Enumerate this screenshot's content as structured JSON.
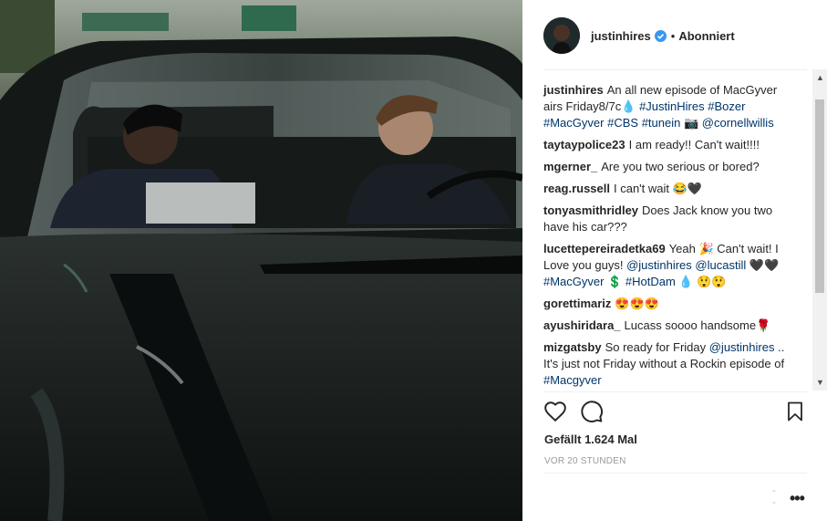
{
  "post": {
    "username": "justinhires",
    "dot": "•",
    "follow_status": "Abonniert",
    "likes": "Gefällt 1.624 Mal",
    "time": "VOR 20 STUNDEN",
    "more_label": "•••"
  },
  "comments": [
    {
      "user": "justinhires",
      "parts": [
        {
          "t": "An all new episode of MacGyver airs Friday8/7c💧 "
        },
        {
          "t": "#JustinHires",
          "link": true
        },
        {
          "t": " "
        },
        {
          "t": "#Bozer",
          "link": true
        },
        {
          "t": " "
        },
        {
          "t": "#MacGyver",
          "link": true
        },
        {
          "t": " "
        },
        {
          "t": "#CBS",
          "link": true
        },
        {
          "t": " "
        },
        {
          "t": "#tunein",
          "link": true
        },
        {
          "t": " 📷 "
        },
        {
          "t": "@cornellwillis",
          "link": true
        }
      ]
    },
    {
      "user": "taytaypolice23",
      "parts": [
        {
          "t": "I am ready!! Can't wait!!!!"
        }
      ]
    },
    {
      "user": "mgerner_",
      "parts": [
        {
          "t": "Are you two serious or bored?"
        }
      ]
    },
    {
      "user": "reag.russell",
      "parts": [
        {
          "t": "I can't wait 😂🖤"
        }
      ]
    },
    {
      "user": "tonyasmithridley",
      "parts": [
        {
          "t": "Does Jack know you two have his car???"
        }
      ]
    },
    {
      "user": "lucettepereiradetka69",
      "parts": [
        {
          "t": "Yeah 🎉 Can't wait! I Love you guys! "
        },
        {
          "t": "@justinhires",
          "link": true
        },
        {
          "t": " "
        },
        {
          "t": "@lucastill",
          "link": true
        },
        {
          "t": " 🖤🖤 "
        },
        {
          "t": "#MacGyver",
          "link": true
        },
        {
          "t": " 💲 "
        },
        {
          "t": "#HotDam",
          "link": true
        },
        {
          "t": " 💧 😲😲"
        }
      ]
    },
    {
      "user": "gorettimariz",
      "parts": [
        {
          "t": "😍😍😍"
        }
      ]
    },
    {
      "user": "ayushiridara_",
      "parts": [
        {
          "t": "Lucass soooo handsome🌹"
        }
      ]
    },
    {
      "user": "mizgatsby",
      "parts": [
        {
          "t": "So ready for Friday "
        },
        {
          "t": "@justinhires",
          "link": true
        },
        {
          "t": " .. It's just not Friday without a Rockin episode of "
        },
        {
          "t": "#Macgyver",
          "link": true
        }
      ]
    }
  ],
  "icons": {
    "verified": "verified-badge-icon",
    "like": "heart-icon",
    "comment": "comment-bubble-icon",
    "save": "bookmark-icon",
    "more": "more-options-icon"
  },
  "colors": {
    "link": "#003569",
    "verified": "#3897f0",
    "muted": "#999999",
    "divider": "#efefef"
  }
}
